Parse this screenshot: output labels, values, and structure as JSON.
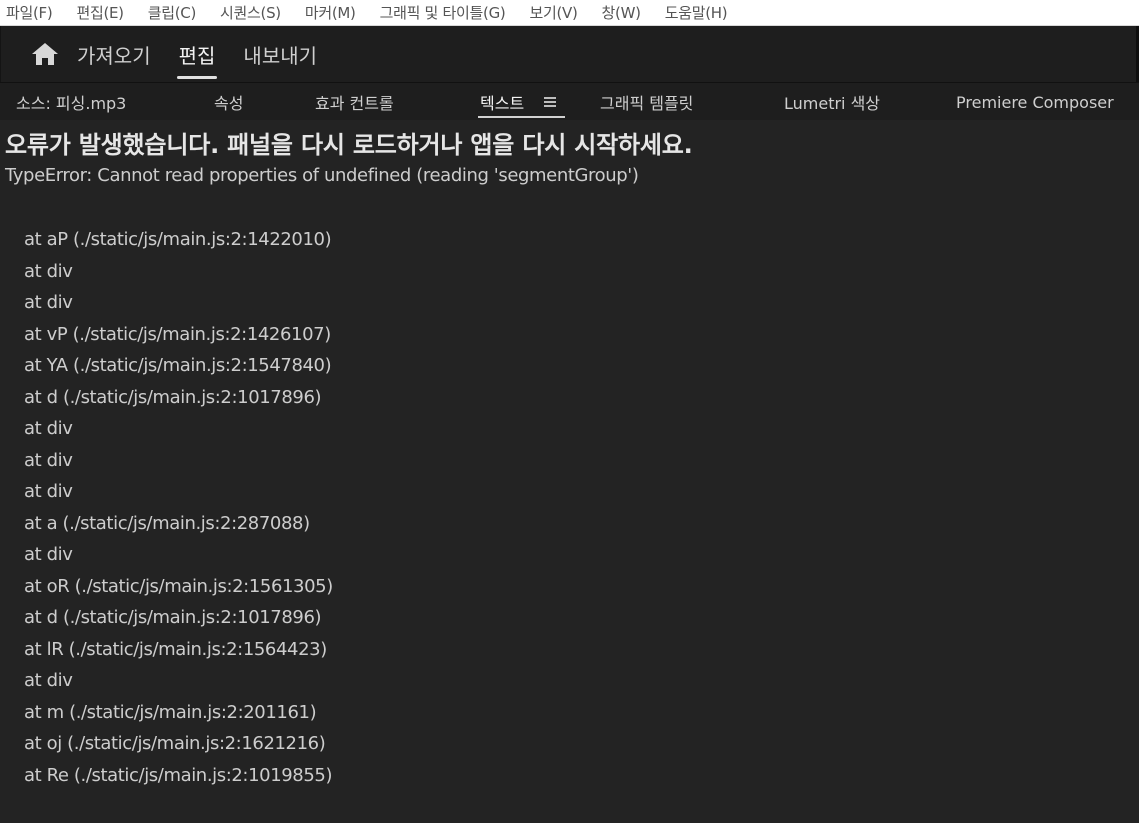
{
  "menubar": {
    "items": [
      "파일(F)",
      "편집(E)",
      "클립(C)",
      "시퀀스(S)",
      "마커(M)",
      "그래픽 및 타이틀(G)",
      "보기(V)",
      "창(W)",
      "도움말(H)"
    ]
  },
  "appbar": {
    "home_icon": "home-icon",
    "tabs": [
      {
        "label": "가져오기",
        "active": false
      },
      {
        "label": "편집",
        "active": true
      },
      {
        "label": "내보내기",
        "active": false
      }
    ]
  },
  "panel_tabs": {
    "items": [
      "소스: 피싱.mp3",
      "속성",
      "효과 컨트롤",
      "텍스트",
      "그래픽 템플릿",
      "Lumetri 색상",
      "Premiere Composer"
    ],
    "active": "텍스트",
    "menu_icon": "hamburger-menu-icon"
  },
  "error": {
    "title": "오류가 발생했습니다. 패널을 다시 로드하거나 앱을 다시 시작하세요.",
    "message": "TypeError: Cannot read properties of undefined (reading 'segmentGroup')",
    "stack": [
      "at aP (./static/js/main.js:2:1422010)",
      "at div",
      "at div",
      "at vP (./static/js/main.js:2:1426107)",
      "at YA (./static/js/main.js:2:1547840)",
      "at d (./static/js/main.js:2:1017896)",
      "at div",
      "at div",
      "at div",
      "at a (./static/js/main.js:2:287088)",
      "at div",
      "at oR (./static/js/main.js:2:1561305)",
      "at d (./static/js/main.js:2:1017896)",
      "at lR (./static/js/main.js:2:1564423)",
      "at div",
      "at m (./static/js/main.js:2:201161)",
      "at oj (./static/js/main.js:2:1621216)",
      "at Re (./static/js/main.js:2:1019855)"
    ]
  },
  "colors": {
    "background": "#232323",
    "header": "#1e1e1e",
    "menubar": "#ffffff",
    "text": "#cdcdcd"
  }
}
